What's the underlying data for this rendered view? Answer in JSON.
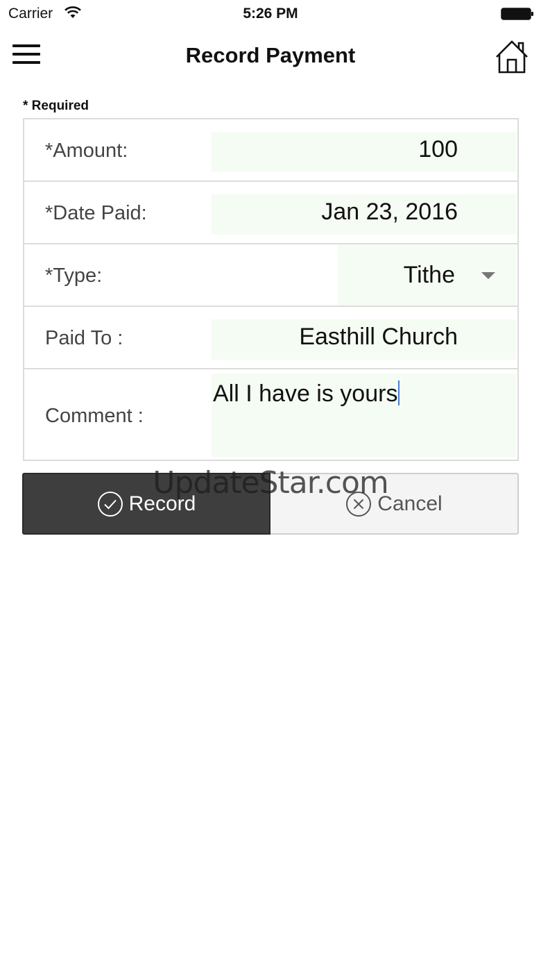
{
  "status_bar": {
    "carrier": "Carrier",
    "time": "5:26 PM",
    "wifi_icon": "wifi-icon",
    "battery_icon": "battery-icon"
  },
  "nav": {
    "title": "Record Payment",
    "menu_icon": "hamburger-menu-icon",
    "home_icon": "home-icon"
  },
  "form": {
    "required_note": "* Required",
    "amount": {
      "label": "*Amount:",
      "value": "100"
    },
    "date_paid": {
      "label": "*Date Paid:",
      "value": "Jan 23, 2016"
    },
    "type": {
      "label": "*Type:",
      "value": "Tithe"
    },
    "paid_to": {
      "label": "Paid To :",
      "value": "Easthill Church"
    },
    "comment": {
      "label": "Comment :",
      "value": "All I have is yours"
    },
    "field_bg_color": "#f5fcf3"
  },
  "actions": {
    "record_label": "Record",
    "cancel_label": "Cancel",
    "record_color": "#3e3e3e",
    "cancel_color": "#f4f4f4"
  },
  "watermark": "UpdateStar.com"
}
